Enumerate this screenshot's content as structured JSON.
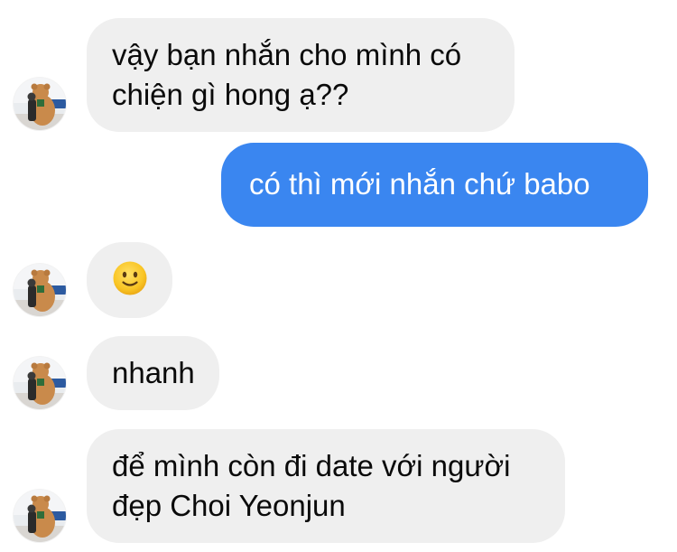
{
  "messages": [
    {
      "from": "other",
      "lines": [
        "vậy bạn nhắn cho mình có",
        "chiện gì hong ạ??"
      ]
    },
    {
      "from": "me",
      "lines": [
        "có thì mới nhắn chứ babo"
      ]
    },
    {
      "from": "other",
      "emoji": "slightly-smiling-face"
    },
    {
      "from": "other",
      "lines": [
        "nhanh"
      ]
    },
    {
      "from": "other",
      "lines": [
        "để mình còn đi date với người",
        "đẹp Choi Yeonjun"
      ]
    }
  ],
  "colors": {
    "incoming_bubble": "#efefef",
    "outgoing_bubble": "#3a86f0",
    "incoming_text": "#0a0a0a",
    "outgoing_text": "#ffffff"
  }
}
